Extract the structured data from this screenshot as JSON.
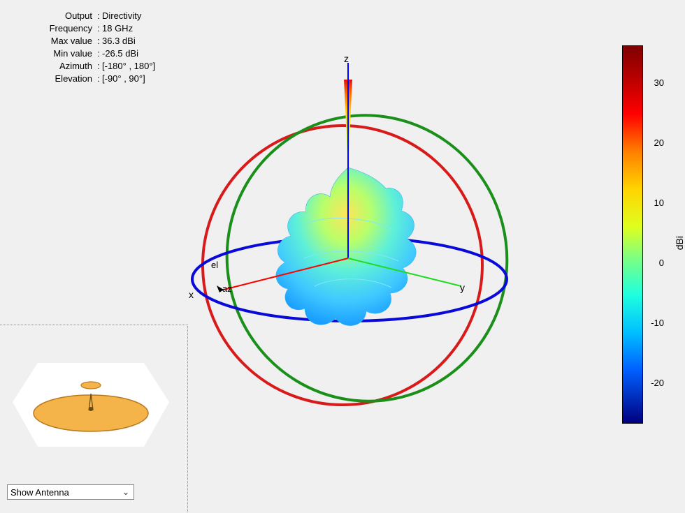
{
  "info": {
    "rows": [
      {
        "k": "Output",
        "v": "Directivity"
      },
      {
        "k": "Frequency",
        "v": "18 GHz"
      },
      {
        "k": "Max value",
        "v": "36.3 dBi"
      },
      {
        "k": "Min value",
        "v": "-26.5 dBi"
      },
      {
        "k": "Azimuth",
        "v": "[-180° , 180°]"
      },
      {
        "k": "Elevation",
        "v": "[-90° , 90°]"
      }
    ]
  },
  "axes": {
    "x": "x",
    "y": "y",
    "z": "z",
    "az": "az",
    "el": "el"
  },
  "colorbar": {
    "unit": "dBi",
    "min": -26.5,
    "max": 36.3,
    "ticks": [
      30,
      20,
      10,
      0,
      -10,
      -20
    ],
    "gradient": [
      {
        "p": 0,
        "c": "#7f0000"
      },
      {
        "p": 8,
        "c": "#b50000"
      },
      {
        "p": 18,
        "c": "#ff0000"
      },
      {
        "p": 28,
        "c": "#ff7f00"
      },
      {
        "p": 38,
        "c": "#ffd400"
      },
      {
        "p": 48,
        "c": "#dfff1f"
      },
      {
        "p": 56,
        "c": "#7fff7f"
      },
      {
        "p": 66,
        "c": "#1fffdf"
      },
      {
        "p": 76,
        "c": "#00bfff"
      },
      {
        "p": 86,
        "c": "#005fff"
      },
      {
        "p": 100,
        "c": "#00007f"
      }
    ]
  },
  "dropdown": {
    "label": "Show Antenna"
  },
  "chart_data": {
    "type": "heatmap",
    "title": "Directivity",
    "quantity": "Directivity",
    "unit": "dBi",
    "frequency_GHz": 18,
    "max_dBi": 36.3,
    "min_dBi": -26.5,
    "azimuth_range_deg": [
      -180,
      180
    ],
    "elevation_range_deg": [
      -90,
      90
    ],
    "colorbar_ticks": [
      30,
      20,
      10,
      0,
      -10,
      -20
    ],
    "axes": [
      "x",
      "y",
      "z"
    ],
    "angular_axes": [
      "az",
      "el"
    ],
    "peak_direction": "+z",
    "notes": "3D spherical radiation pattern; colors map directivity in dBi per colorbar."
  }
}
